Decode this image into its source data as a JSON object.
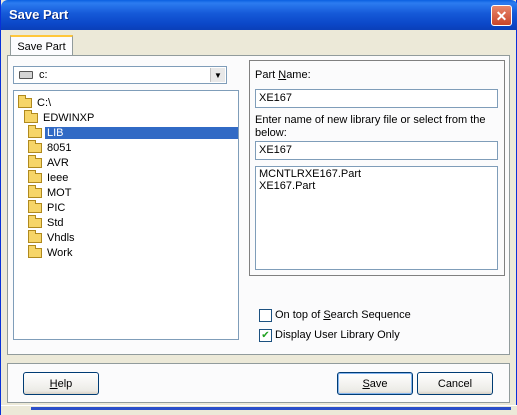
{
  "window": {
    "title": "Save Part",
    "close_symbol": "✕"
  },
  "tab": {
    "label": "Save Part"
  },
  "drive": {
    "value": "c:"
  },
  "tree": {
    "items": [
      {
        "label": "C:\\",
        "depth": 0,
        "selected": false
      },
      {
        "label": "EDWINXP",
        "depth": 1,
        "selected": false
      },
      {
        "label": "LIB",
        "depth": 2,
        "selected": true
      },
      {
        "label": "8051",
        "depth": 3,
        "selected": false
      },
      {
        "label": "AVR",
        "depth": 3,
        "selected": false
      },
      {
        "label": "Ieee",
        "depth": 3,
        "selected": false
      },
      {
        "label": "MOT",
        "depth": 3,
        "selected": false
      },
      {
        "label": "PIC",
        "depth": 3,
        "selected": false
      },
      {
        "label": "Std",
        "depth": 3,
        "selected": false
      },
      {
        "label": "Vhdls",
        "depth": 3,
        "selected": false
      },
      {
        "label": "Work",
        "depth": 3,
        "selected": false
      }
    ]
  },
  "form": {
    "part_name_label_pre": "Part ",
    "part_name_label_u": "N",
    "part_name_label_post": "ame:",
    "part_name_value": "XE167",
    "library_label_line1": "Enter name of new library file or select from the",
    "library_label_line2": "below:",
    "library_value": "XE167",
    "library_items": [
      "MCNTLRXE167.Part",
      "XE167.Part"
    ]
  },
  "options": {
    "top_of_search_pre": "On top of ",
    "top_of_search_u": "S",
    "top_of_search_post": "earch Sequence",
    "top_of_search_checked": false,
    "display_user_lib": "Display User Library Only",
    "display_user_lib_checked": true
  },
  "buttons": {
    "help_u": "H",
    "help_rest": "elp",
    "save_u": "S",
    "save_rest": "ave",
    "cancel": "Cancel"
  }
}
